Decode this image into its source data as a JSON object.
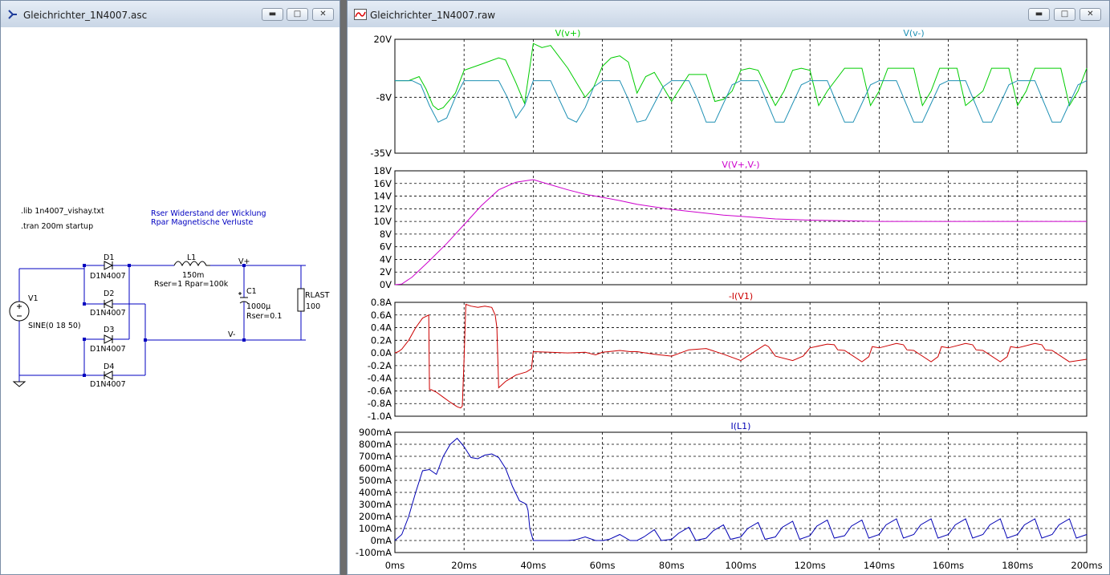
{
  "schematic_window": {
    "title": "Gleichrichter_1N4007.asc",
    "directives": [
      ".lib 1n4007_vishay.txt",
      ".tran 200m startup"
    ],
    "comments": [
      "Rser Widerstand der Wicklung",
      "Rpar Magnetische Verluste"
    ],
    "components": {
      "v1_name": "V1",
      "v1_value": "SINE(0 18 50)",
      "d1_name": "D1",
      "d1_model": "D1N4007",
      "d2_name": "D2",
      "d2_model": "D1N4007",
      "d3_name": "D3",
      "d3_model": "D1N4007",
      "d4_name": "D4",
      "d4_model": "D1N4007",
      "l1_name": "L1",
      "l1_value": "150m",
      "l1_params": "Rser=1 Rpar=100k",
      "c1_name": "C1",
      "c1_value": "1000µ",
      "c1_params": "Rser=0.1",
      "rlast_name": "RLAST",
      "rlast_value": "100"
    },
    "net_labels": {
      "vplus": "V+",
      "vminus": "V-"
    }
  },
  "waveform_window": {
    "title": "Gleichrichter_1N4007.raw",
    "x_ticks": [
      "0ms",
      "20ms",
      "40ms",
      "60ms",
      "80ms",
      "100ms",
      "120ms",
      "140ms",
      "160ms",
      "180ms",
      "200ms"
    ]
  },
  "chart_data": [
    {
      "type": "line",
      "xlabel": "",
      "x_unit": "ms",
      "xlim": [
        0,
        200
      ],
      "ylim": [
        -35,
        20
      ],
      "y_ticks": [
        "20V",
        "-8V",
        "-35V"
      ],
      "grid": true,
      "series": [
        {
          "name": "V(v+)",
          "color": "#00cc00",
          "x": [
            0,
            4,
            7,
            9,
            11,
            12.5,
            14,
            17.5,
            20,
            25,
            30,
            32,
            35,
            37.5,
            40,
            42.5,
            45,
            50,
            55,
            57.5,
            60,
            62.5,
            65,
            67.5,
            70,
            72.5,
            75,
            80,
            85,
            90,
            92.5,
            95,
            97.5,
            100,
            102.5,
            105,
            110,
            112.5,
            115,
            117.5,
            120,
            122.5,
            125,
            130,
            132.5,
            135,
            137.5,
            140,
            142.5,
            145,
            150,
            152.5,
            155,
            157.5,
            160,
            162.5,
            165,
            170,
            172.5,
            175,
            177.5,
            180,
            182.5,
            185,
            190,
            192.5,
            195,
            197.5,
            200
          ],
          "y": [
            0,
            0,
            2,
            -4,
            -12,
            -14,
            -13,
            -6,
            5,
            8,
            11,
            10,
            -1,
            -11,
            18,
            16,
            17,
            6,
            -8,
            -3,
            7,
            11,
            12,
            9,
            -6,
            2,
            4,
            -10,
            3,
            3,
            -10,
            -9,
            -5,
            5,
            6,
            5,
            -12,
            -5,
            5,
            6,
            5,
            -12,
            -5,
            6,
            6,
            6,
            -12,
            -5,
            6,
            6,
            6,
            -12,
            -5,
            6,
            6,
            6,
            -12,
            -5,
            6,
            6,
            6,
            -12,
            -5,
            6,
            6,
            6,
            -12,
            -5,
            6
          ]
        },
        {
          "name": "V(v-)",
          "color": "#1e90b4",
          "x": [
            0,
            5,
            7.5,
            10,
            12.5,
            15,
            17.5,
            20,
            22.5,
            25,
            30,
            32.5,
            35,
            37.5,
            40,
            42.5,
            45,
            47.5,
            50,
            52.5,
            55,
            57.5,
            60,
            62.5,
            65,
            67.5,
            70,
            72.5,
            75,
            77.5,
            80,
            82.5,
            85,
            87.5,
            90,
            92.5,
            95,
            97.5,
            100,
            102.5,
            105,
            107.5,
            110,
            112.5,
            115,
            117.5,
            120,
            122.5,
            125,
            127.5,
            130,
            132.5,
            135,
            137.5,
            140,
            142.5,
            145,
            147.5,
            150,
            152.5,
            155,
            157.5,
            160,
            162.5,
            165,
            167.5,
            170,
            172.5,
            175,
            177.5,
            180,
            182.5,
            185,
            187.5,
            190,
            192.5,
            195,
            197.5,
            200
          ],
          "y": [
            0,
            0,
            -2,
            -12,
            -20,
            -18,
            -8,
            0,
            0,
            0,
            0,
            -8,
            -18,
            -12,
            0,
            0,
            0,
            -9,
            -18,
            -20,
            -13,
            -3,
            0,
            0,
            0,
            -9,
            -20,
            -19,
            -11,
            -3,
            0,
            0,
            0,
            -9,
            -20,
            -20,
            -11,
            -2,
            0,
            0,
            0,
            -10,
            -20,
            -20,
            -11,
            -2,
            0,
            0,
            0,
            -10,
            -20,
            -20,
            -11,
            -2,
            0,
            0,
            0,
            -10,
            -20,
            -20,
            -11,
            -2,
            0,
            0,
            0,
            -10,
            -20,
            -20,
            -11,
            -2,
            0,
            0,
            0,
            -10,
            -20,
            -20,
            -11,
            -2,
            0
          ]
        }
      ]
    },
    {
      "type": "line",
      "xlabel": "",
      "x_unit": "ms",
      "xlim": [
        0,
        200
      ],
      "ylim": [
        0,
        18
      ],
      "y_ticks": [
        "18V",
        "16V",
        "14V",
        "12V",
        "10V",
        "8V",
        "6V",
        "4V",
        "2V",
        "0V"
      ],
      "grid": true,
      "series": [
        {
          "name": "V(V+,V-)",
          "color": "#cc00cc",
          "x": [
            0,
            2,
            5,
            10,
            15,
            20,
            25,
            30,
            35,
            40,
            45,
            50,
            55,
            60,
            65,
            70,
            75,
            80,
            85,
            90,
            95,
            100,
            110,
            120,
            130,
            140,
            150,
            160,
            170,
            180,
            190,
            200
          ],
          "y": [
            0,
            0.1,
            1.2,
            3.8,
            6.5,
            9.5,
            12.5,
            15,
            16.2,
            16.6,
            15.8,
            15,
            14.3,
            13.8,
            13.3,
            12.7,
            12.3,
            11.9,
            11.6,
            11.3,
            11,
            10.8,
            10.4,
            10.2,
            10.1,
            10,
            10,
            10,
            10,
            10,
            10,
            10
          ]
        }
      ]
    },
    {
      "type": "line",
      "xlabel": "",
      "x_unit": "ms",
      "xlim": [
        0,
        200
      ],
      "ylim": [
        -1.0,
        0.8
      ],
      "y_ticks": [
        "0.8A",
        "0.6A",
        "0.4A",
        "0.2A",
        "0.0A",
        "-0.2A",
        "-0.4A",
        "-0.6A",
        "-0.8A",
        "-1.0A"
      ],
      "grid": true,
      "series": [
        {
          "name": "-I(V1)",
          "color": "#cc0000",
          "x": [
            0,
            1,
            2,
            4,
            6,
            8,
            9.8,
            10,
            10.5,
            12,
            14,
            16,
            18,
            19,
            19.5,
            20,
            20.5,
            22,
            24,
            26,
            28,
            29,
            29.5,
            30,
            32,
            35,
            38,
            39.5,
            40,
            45,
            50,
            55,
            58,
            60,
            65,
            68,
            70,
            75,
            80,
            85,
            90,
            95,
            100,
            105,
            107,
            108,
            110,
            115,
            118,
            120,
            125,
            127,
            128,
            130,
            135,
            137,
            138,
            140,
            145,
            147,
            148,
            150,
            155,
            157,
            158,
            160,
            165,
            167,
            168,
            170,
            175,
            177,
            178,
            180,
            185,
            187,
            188,
            190,
            195,
            200
          ],
          "y": [
            0,
            0.02,
            0.06,
            0.2,
            0.4,
            0.55,
            0.6,
            -0.58,
            -0.58,
            -0.62,
            -0.7,
            -0.78,
            -0.85,
            -0.87,
            -0.84,
            -0.1,
            0.77,
            0.74,
            0.72,
            0.74,
            0.72,
            0.6,
            0.4,
            -0.55,
            -0.45,
            -0.35,
            -0.3,
            -0.25,
            0.02,
            0.01,
            0,
            0.01,
            -0.03,
            0.01,
            0.04,
            0.02,
            0.02,
            -0.02,
            -0.05,
            0.05,
            0.07,
            -0.02,
            -0.12,
            0.06,
            0.13,
            0.1,
            -0.05,
            -0.12,
            -0.05,
            0.08,
            0.14,
            0.13,
            0.05,
            0.04,
            -0.14,
            -0.06,
            0.1,
            0.08,
            0.15,
            0.13,
            0.05,
            0.04,
            -0.14,
            -0.06,
            0.1,
            0.08,
            0.15,
            0.13,
            0.05,
            0.04,
            -0.14,
            -0.06,
            0.1,
            0.08,
            0.15,
            0.13,
            0.05,
            0.04,
            -0.14,
            -0.1
          ]
        }
      ]
    },
    {
      "type": "line",
      "xlabel": "",
      "x_unit": "ms",
      "xlim": [
        0,
        200
      ],
      "ylim": [
        -100,
        900
      ],
      "y_ticks": [
        "900mA",
        "800mA",
        "700mA",
        "600mA",
        "500mA",
        "400mA",
        "300mA",
        "200mA",
        "100mA",
        "0mA",
        "-100mA"
      ],
      "grid": true,
      "series": [
        {
          "name": "I(L1)",
          "color": "#0000b4",
          "x": [
            0,
            2,
            4,
            6,
            8,
            10,
            12,
            14,
            16,
            18,
            20,
            22,
            24,
            26,
            28,
            30,
            32,
            34,
            36,
            37.5,
            38,
            38.5,
            39,
            40,
            45,
            50,
            52,
            55,
            58,
            60,
            62,
            65,
            68,
            70,
            72,
            75,
            77,
            80,
            82,
            85,
            87,
            90,
            92,
            95,
            97,
            100,
            102,
            105,
            107,
            110,
            112,
            115,
            117,
            120,
            122,
            125,
            127,
            130,
            132,
            135,
            137,
            140,
            142,
            145,
            147,
            150,
            152,
            155,
            157,
            160,
            162,
            165,
            167,
            170,
            172,
            175,
            177,
            180,
            182,
            185,
            187,
            190,
            192,
            195,
            197,
            200
          ],
          "y": [
            0,
            50,
            200,
            400,
            580,
            590,
            550,
            700,
            800,
            850,
            780,
            690,
            680,
            710,
            720,
            690,
            600,
            450,
            330,
            310,
            300,
            250,
            100,
            0,
            0,
            0,
            5,
            30,
            0,
            0,
            10,
            50,
            0,
            0,
            30,
            90,
            0,
            10,
            60,
            110,
            0,
            20,
            80,
            130,
            10,
            30,
            100,
            150,
            10,
            30,
            110,
            160,
            10,
            40,
            120,
            170,
            20,
            40,
            120,
            170,
            20,
            50,
            130,
            180,
            20,
            50,
            130,
            180,
            20,
            50,
            130,
            180,
            20,
            50,
            130,
            180,
            20,
            50,
            130,
            180,
            20,
            50,
            130,
            180,
            20,
            50
          ]
        }
      ]
    }
  ]
}
